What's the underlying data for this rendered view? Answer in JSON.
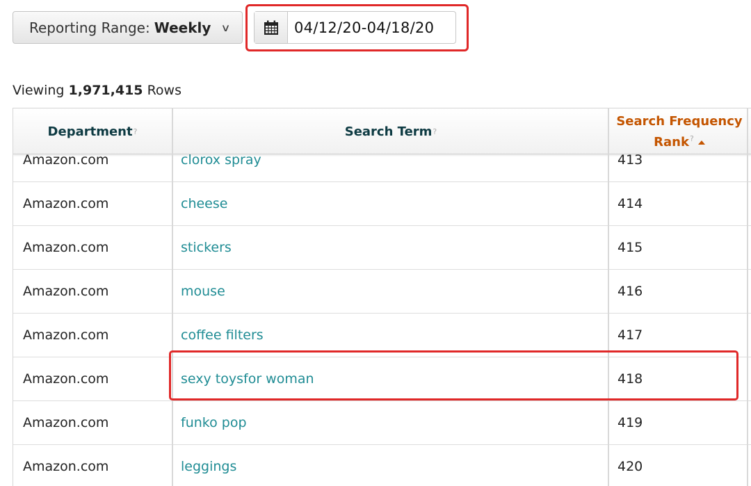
{
  "filters": {
    "range_label": "Reporting Range:",
    "range_value": "Weekly",
    "date_start": "04/12/20",
    "date_separator": "-",
    "date_end": "04/18/20"
  },
  "summary": {
    "prefix": "Viewing",
    "count": "1,971,415",
    "suffix": "Rows"
  },
  "table": {
    "columns": [
      "Department",
      "Search Term",
      "Search Frequency",
      "Rank"
    ],
    "help_mark": "?",
    "rows": [
      {
        "department": "Amazon.com",
        "term": "clorox spray",
        "rank": "413"
      },
      {
        "department": "Amazon.com",
        "term": "cheese",
        "rank": "414"
      },
      {
        "department": "Amazon.com",
        "term": "stickers",
        "rank": "415"
      },
      {
        "department": "Amazon.com",
        "term": "mouse",
        "rank": "416"
      },
      {
        "department": "Amazon.com",
        "term": "coffee filters",
        "rank": "417"
      },
      {
        "department": "Amazon.com",
        "term": "sexy toysfor woman",
        "rank": "418"
      },
      {
        "department": "Amazon.com",
        "term": "funko pop",
        "rank": "419"
      },
      {
        "department": "Amazon.com",
        "term": "leggings",
        "rank": "420"
      }
    ]
  },
  "colors": {
    "link": "#1f8c94",
    "sort_header": "#c45500",
    "highlight": "#e02828"
  },
  "icons": {
    "calendar": "calendar-icon",
    "dropdown": "chevron-down-icon",
    "sort": "sort-ascending-icon"
  }
}
